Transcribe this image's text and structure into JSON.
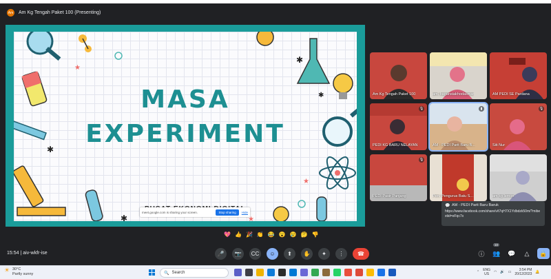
{
  "meeting": {
    "presenter_badge": "Am",
    "presenter_label": "Am Kg Tengah Paket 100 (Presenting)",
    "time": "15:54",
    "separator": "|",
    "code": "aiv-wkfr-ise"
  },
  "slide": {
    "title_line1": "MASA",
    "title_line2": "EXPERIMENT",
    "bottom_text": "PUSAT EKONOMI DIGITAL",
    "share_text": "meet.google.com is sharing your screen.",
    "stop_sharing": "Stop sharing",
    "hide": "Hide"
  },
  "participants": [
    {
      "name": "Am Kg Tengah Paket 100"
    },
    {
      "name": "am. bagansiakhodasmar"
    },
    {
      "name": "AM PEDI SE Pardana"
    },
    {
      "name": "PEDI KG BARU NELAYAN"
    },
    {
      "name": "AM - PEDI Parit Baru B..."
    },
    {
      "name": "Siti Nur"
    },
    {
      "name": "PEDI Pasir Panjang"
    },
    {
      "name": "Pen. Pengurus Batu S..."
    },
    {
      "name": "am kg lemon"
    }
  ],
  "chat_preview": {
    "from": "AM - PEDI Parit Baru Baruk",
    "message": "https://www.facebook.com/share/v/t7qH7X1Ydbdzk50m/?mibextid=eFqc7x"
  },
  "reactions": [
    "💖",
    "👍",
    "🎉",
    "👏",
    "😂",
    "😮",
    "😢",
    "🤔",
    "👎"
  ],
  "controls": {
    "participant_count": "10"
  },
  "taskbar": {
    "weather_temp": "30°C",
    "weather_desc": "Partly sunny",
    "search_placeholder": "Search",
    "lang": "ENG",
    "region": "US",
    "time": "3:54 PM",
    "date": "20/12/2023"
  },
  "colors": {
    "slide_teal": "#1a9c9a",
    "title_teal": "#1d8f92",
    "end_call": "#ea4335",
    "accent_blue": "#8ab4f8"
  }
}
